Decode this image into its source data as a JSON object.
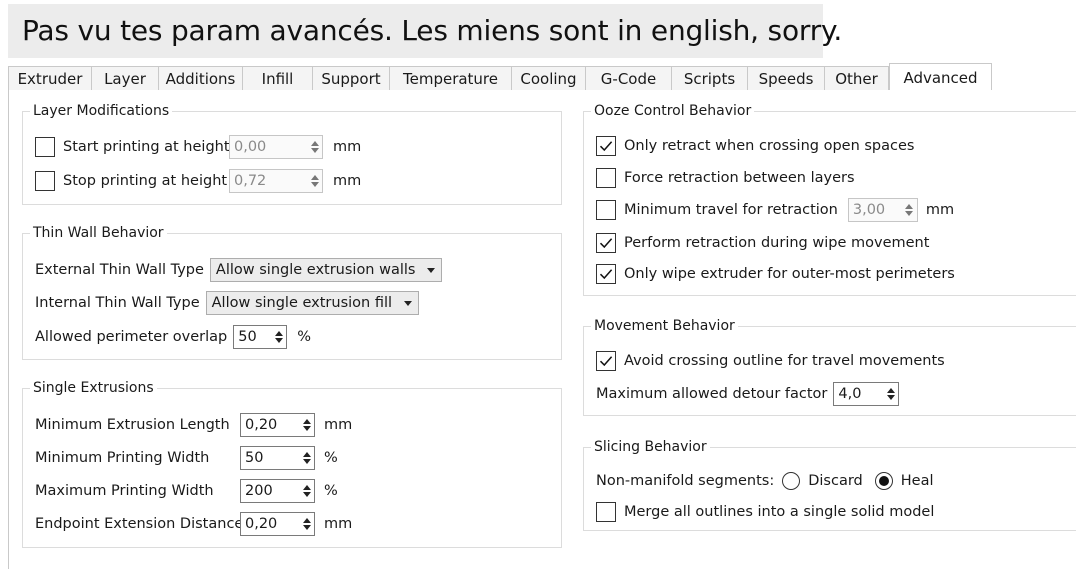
{
  "caption": "Pas vu tes param avancés. Les miens sont in english, sorry.",
  "tabs": [
    "Extruder",
    "Layer",
    "Additions",
    "Infill",
    "Support",
    "Temperature",
    "Cooling",
    "G-Code",
    "Scripts",
    "Speeds",
    "Other",
    "Advanced"
  ],
  "active_tab": "Advanced",
  "layer_mod": {
    "title": "Layer Modifications",
    "start": {
      "label": "Start printing at height",
      "value": "0,00",
      "unit": "mm",
      "checked": false
    },
    "stop": {
      "label": "Stop printing at height",
      "value": "0,72",
      "unit": "mm",
      "checked": false
    }
  },
  "thin_wall": {
    "title": "Thin Wall Behavior",
    "external": {
      "label": "External Thin Wall Type",
      "value": "Allow single extrusion walls"
    },
    "internal": {
      "label": "Internal Thin Wall Type",
      "value": "Allow single extrusion fill"
    },
    "overlap": {
      "label": "Allowed perimeter overlap",
      "value": "50",
      "unit": "%"
    }
  },
  "single_ext": {
    "title": "Single Extrusions",
    "min_len": {
      "label": "Minimum Extrusion Length",
      "value": "0,20",
      "unit": "mm"
    },
    "min_width": {
      "label": "Minimum Printing Width",
      "value": "50",
      "unit": "%"
    },
    "max_width": {
      "label": "Maximum Printing Width",
      "value": "200",
      "unit": "%"
    },
    "endpoint": {
      "label": "Endpoint Extension Distance",
      "value": "0,20",
      "unit": "mm"
    }
  },
  "ooze": {
    "title": "Ooze Control Behavior",
    "retract_open": {
      "label": "Only retract when crossing open spaces",
      "checked": true
    },
    "force_retract": {
      "label": "Force retraction between layers",
      "checked": false
    },
    "min_travel": {
      "label": "Minimum travel for retraction",
      "value": "3,00",
      "unit": "mm",
      "checked": false
    },
    "wipe_retract": {
      "label": "Perform retraction during wipe movement",
      "checked": true
    },
    "wipe_outer": {
      "label": "Only wipe extruder for outer-most perimeters",
      "checked": true
    }
  },
  "movement": {
    "title": "Movement Behavior",
    "avoid": {
      "label": "Avoid crossing outline for travel movements",
      "checked": true
    },
    "detour": {
      "label": "Maximum allowed detour factor",
      "value": "4,0"
    }
  },
  "slicing": {
    "title": "Slicing Behavior",
    "nonmanifold": {
      "label": "Non-manifold segments:",
      "discard": "Discard",
      "heal": "Heal",
      "selected": "Heal"
    },
    "merge": {
      "label": "Merge all outlines into a single solid model",
      "checked": false
    }
  }
}
